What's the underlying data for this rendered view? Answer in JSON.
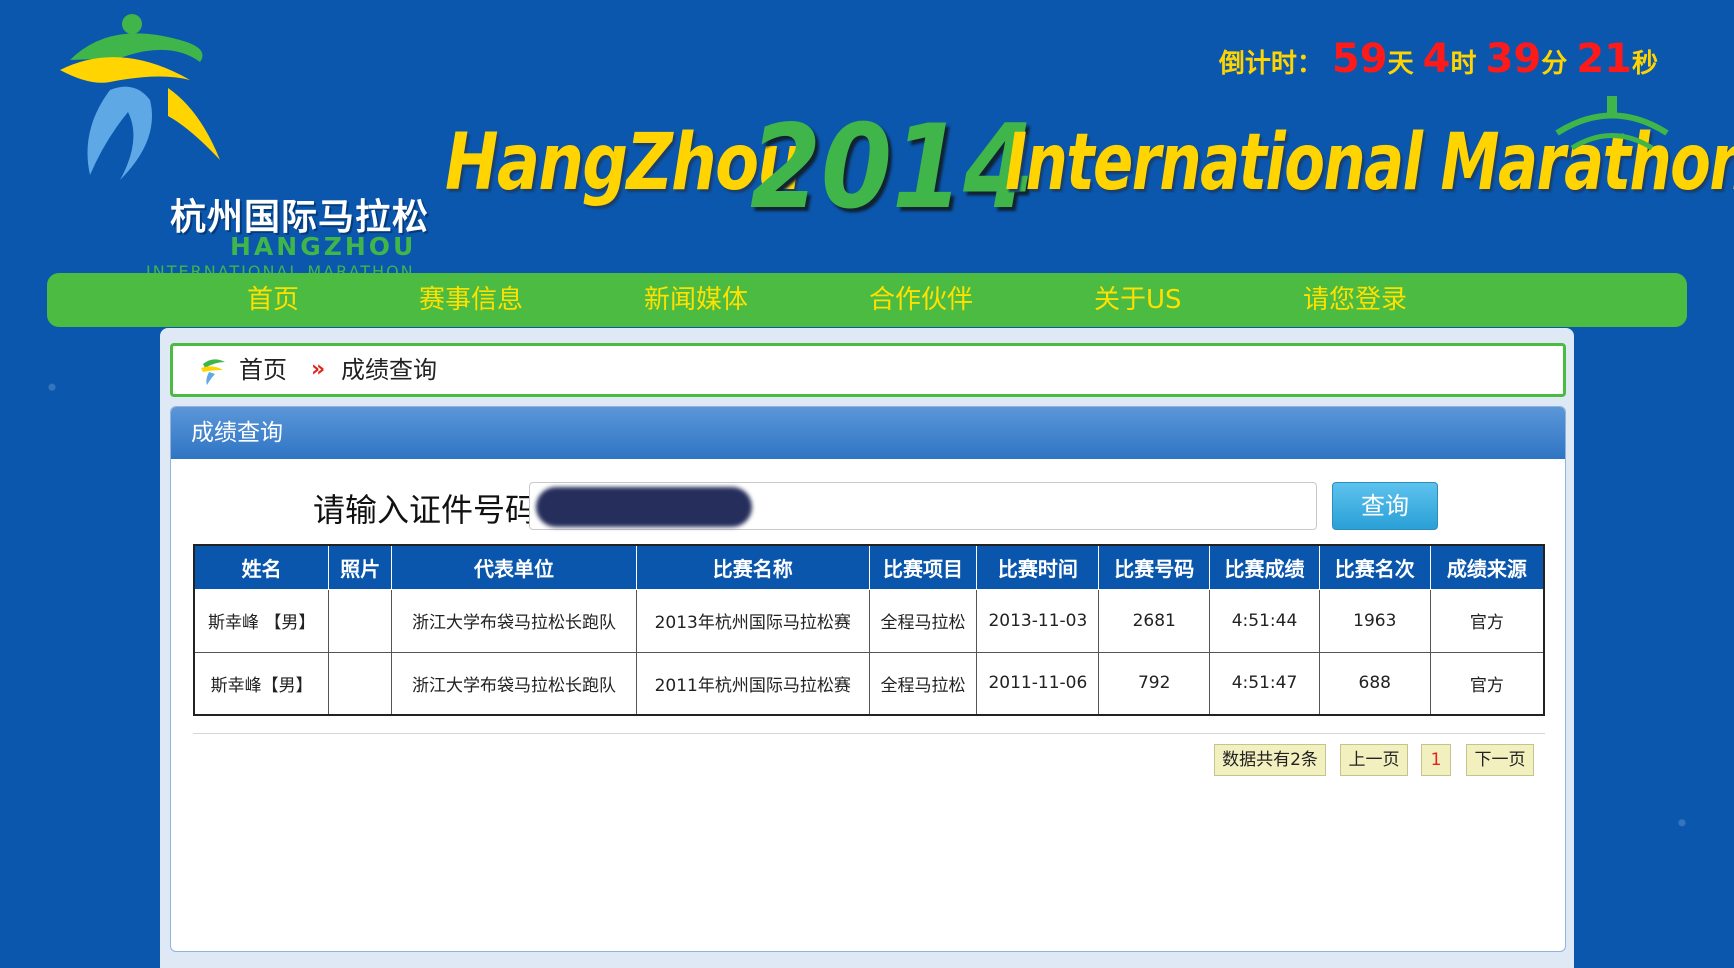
{
  "brand": {
    "logo_cn": "杭州国际马拉松",
    "logo_en_line1": "HANGZHOU",
    "logo_en_line2": "INTERNATIONAL MARATHON",
    "banner_part1": "HangZhou",
    "banner_year": "2014",
    "banner_part2": "International Marathon"
  },
  "countdown": {
    "label": "倒计时：",
    "days": "59",
    "days_unit": "天",
    "hours": "4",
    "hours_unit": "时",
    "minutes": "39",
    "minutes_unit": "分",
    "seconds": "21",
    "seconds_unit": "秒"
  },
  "nav": {
    "items": [
      "首页",
      "赛事信息",
      "新闻媒体",
      "合作伙伴",
      "关于US",
      "请您登录"
    ]
  },
  "breadcrumb": {
    "home": "首页",
    "separator": "»",
    "current": "成绩查询"
  },
  "panel": {
    "title": "成绩查询"
  },
  "search": {
    "label": "请输入证件号码",
    "button": "查询"
  },
  "table": {
    "headers": [
      "姓名",
      "照片",
      "代表单位",
      "比赛名称",
      "比赛项目",
      "比赛时间",
      "比赛号码",
      "比赛成绩",
      "比赛名次",
      "成绩来源"
    ],
    "rows": [
      [
        "斯幸峰 【男】",
        "",
        "浙江大学布袋马拉松长跑队",
        "2013年杭州国际马拉松赛",
        "全程马拉松",
        "2013-11-03",
        "2681",
        "4:51:44",
        "1963",
        "官方"
      ],
      [
        "斯幸峰【男】",
        "",
        "浙江大学布袋马拉松长跑队",
        "2011年杭州国际马拉松赛",
        "全程马拉松",
        "2011-11-06",
        "792",
        "4:51:47",
        "688",
        "官方"
      ]
    ]
  },
  "pagination": {
    "total": "数据共有2条",
    "prev": "上一页",
    "current": "1",
    "next": "下一页"
  },
  "colors": {
    "background": "#0a57ad",
    "nav_green": "#4bbb41",
    "nav_text": "#ffe000",
    "table_header": "#0b56ad",
    "countdown_number": "#ff1a1a"
  }
}
